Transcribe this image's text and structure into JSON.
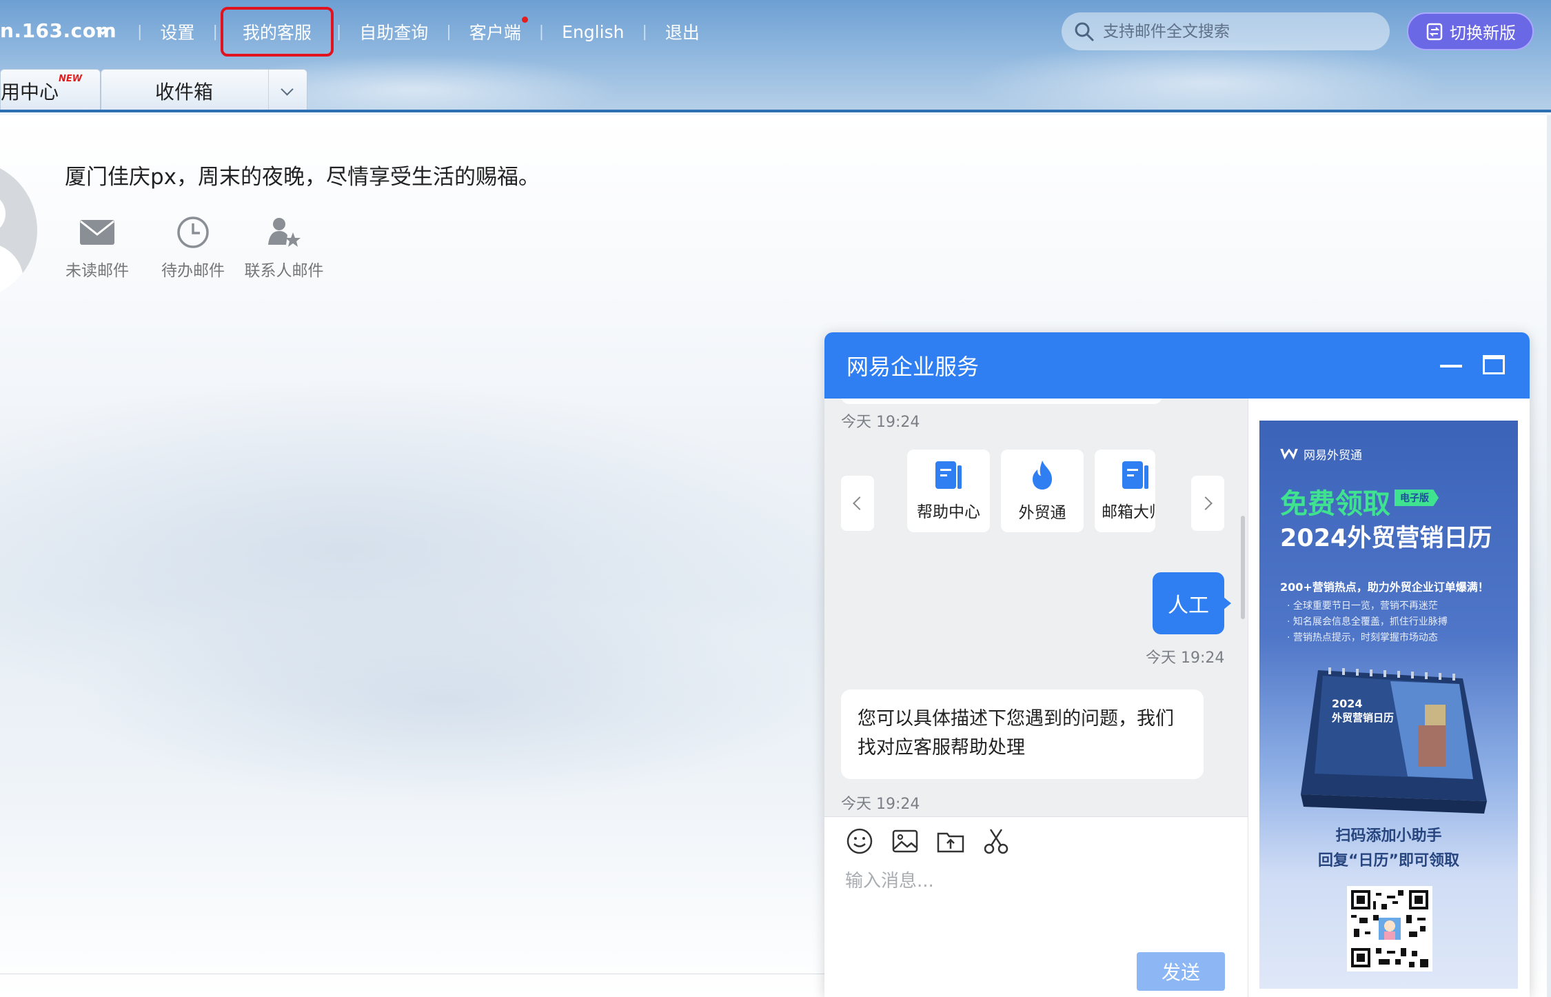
{
  "header": {
    "domain": "n.163.com",
    "nav": [
      {
        "label": "设置"
      },
      {
        "label": "我的客服"
      },
      {
        "label": "自助查询"
      },
      {
        "label": "客户端"
      },
      {
        "label": "English"
      },
      {
        "label": "退出"
      }
    ],
    "search_placeholder": "支持邮件全文搜索",
    "switch_label": "切换新版"
  },
  "tabs": [
    {
      "label": "用中心",
      "badge": "NEW"
    },
    {
      "label": "收件箱"
    }
  ],
  "home": {
    "greeting": "厦门佳庆px，周末的夜晚，尽情享受生活的赐福。",
    "quick_links": [
      {
        "label": "未读邮件",
        "icon": "envelope-icon"
      },
      {
        "label": "待办邮件",
        "icon": "clock-icon"
      },
      {
        "label": "联系人邮件",
        "icon": "contact-star-icon"
      }
    ]
  },
  "chat": {
    "title": "网易企业服务",
    "timestamps": [
      "今天 19:24",
      "今天 19:24",
      "今天 19:24"
    ],
    "cards": [
      {
        "label": "帮助中心",
        "icon": "book-icon"
      },
      {
        "label": "外贸通",
        "icon": "flame-icon"
      },
      {
        "label": "邮箱大师",
        "icon": "book-icon"
      }
    ],
    "user_message": "人工",
    "bot_message": "您可以具体描述下您遇到的问题，我们找对应客服帮助处理",
    "input_placeholder": "输入消息...",
    "send_label": "发送",
    "tools": [
      "emoji-icon",
      "image-icon",
      "upload-icon",
      "scissors-icon"
    ]
  },
  "ad": {
    "brand": "网易外贸通",
    "headline": "免费领取",
    "tag": "电子版",
    "title": "2024外贸营销日历",
    "subtitle": "200+营销热点，助力外贸企业订单爆满！",
    "bullets": [
      "全球重要节日一览，营销不再迷茫",
      "知名展会信息全覆盖，抓住行业脉搏",
      "营销热点提示，时刻掌握市场动态"
    ],
    "calendar_title_year": "2024",
    "calendar_title": "外贸营销日历",
    "cta_line1": "扫码添加小助手",
    "cta_line2": "回复“日历”即可领取"
  },
  "colors": {
    "accent": "#2f7ff3",
    "highlight_box": "#e0131f",
    "switch_button": "#6b68e6",
    "ad_green": "#3ee28f"
  }
}
